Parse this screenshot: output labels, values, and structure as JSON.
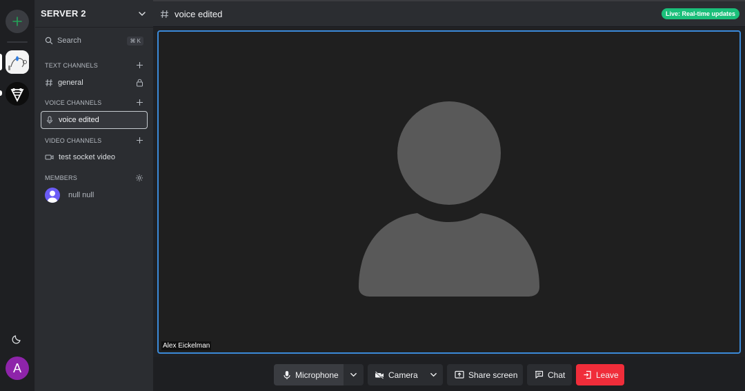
{
  "sidebar": {
    "server_name": "SERVER 2",
    "search": {
      "label": "Search",
      "shortcut": "⌘ K"
    },
    "sections": {
      "text": "TEXT CHANNELS",
      "voice": "VOICE CHANNELS",
      "video": "VIDEO CHANNELS",
      "members": "MEMBERS"
    },
    "channels": {
      "text": [
        {
          "label": "general",
          "locked": true
        }
      ],
      "voice": [
        {
          "label": "voice edited",
          "active": true
        }
      ],
      "video": [
        {
          "label": "test socket video"
        }
      ]
    },
    "members": [
      {
        "label": "null null"
      }
    ]
  },
  "rail": {
    "user_initial": "A",
    "user_avatar_color": "#8e24aa",
    "add_color": "#23a559"
  },
  "header": {
    "channel_title": "voice edited",
    "live_badge": "Live: Real-time updates",
    "live_color": "#1bbf7a"
  },
  "video": {
    "participant_name": "Alex Eickelman",
    "active_border_color": "#3b8ad9"
  },
  "controls": {
    "microphone": "Microphone",
    "camera": "Camera",
    "share_screen": "Share screen",
    "chat": "Chat",
    "leave": "Leave",
    "leave_color": "#f02d3a"
  }
}
